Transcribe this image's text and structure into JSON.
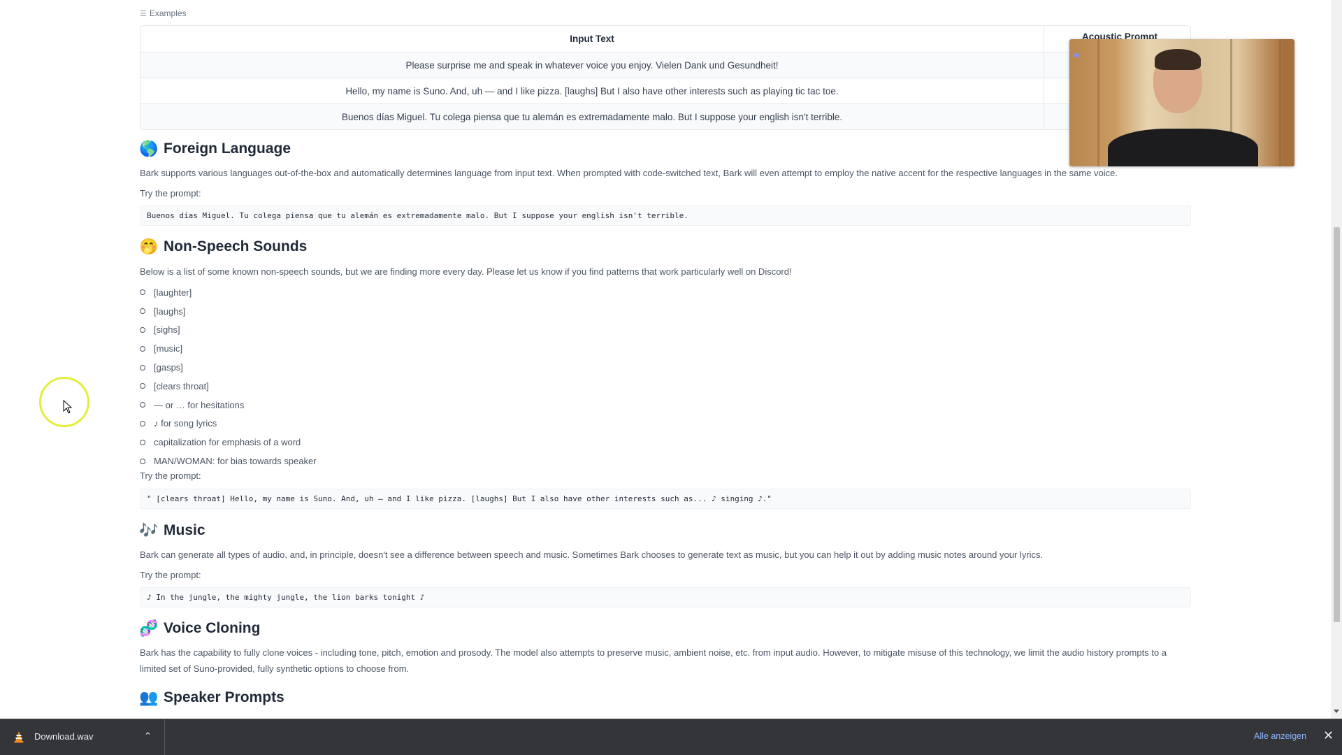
{
  "examples": {
    "label": "Examples",
    "columns": [
      "Input Text",
      "Acoustic Prompt"
    ],
    "rows": [
      {
        "input_text": "Please surprise me and speak in whatever voice you enjoy. Vielen Dank und Gesundheit!",
        "acoustic_prompt": ""
      },
      {
        "input_text": "Hello, my name is Suno. And, uh — and I like pizza. [laughs] But I also have other interests such as playing tic tac toe.",
        "acoustic_prompt": ""
      },
      {
        "input_text": "Buenos días Miguel. Tu colega piensa que tu alemán es extremadamente malo. But I suppose your english isn't terrible.",
        "acoustic_prompt": ""
      }
    ]
  },
  "sections": {
    "foreign_language": {
      "icon": "🌎",
      "title": "Foreign Language",
      "description": "Bark supports various languages out-of-the-box and automatically determines language from input text. When prompted with code-switched text, Bark will even attempt to employ the native accent for the respective languages in the same voice.",
      "try_label": "Try the prompt:",
      "prompt": "Buenos días Miguel. Tu colega piensa que tu alemán es extremadamente malo. But I suppose your english isn't terrible."
    },
    "non_speech": {
      "icon": "🤭",
      "title": "Non-Speech Sounds",
      "description": "Below is a list of some known non-speech sounds, but we are finding more every day. Please let us know if you find patterns that work particularly well on Discord!",
      "items": [
        "[laughter]",
        "[laughs]",
        "[sighs]",
        "[music]",
        "[gasps]",
        "[clears throat]",
        "— or … for hesitations",
        "♪ for song lyrics",
        "capitalization for emphasis of a word",
        "MAN/WOMAN: for bias towards speaker"
      ],
      "try_label": "Try the prompt:",
      "prompt": "\" [clears throat] Hello, my name is Suno. And, uh — and I like pizza. [laughs] But I also have other interests such as... ♪ singing ♪.\""
    },
    "music": {
      "icon": "🎶",
      "title": "Music",
      "description": "Bark can generate all types of audio, and, in principle, doesn't see a difference between speech and music. Sometimes Bark chooses to generate text as music, but you can help it out by adding music notes around your lyrics.",
      "try_label": "Try the prompt:",
      "prompt": "♪ In the jungle, the mighty jungle, the lion barks tonight ♪"
    },
    "voice_cloning": {
      "icon": "🧬",
      "title": "Voice Cloning",
      "description": "Bark has the capability to fully clone voices - including tone, pitch, emotion and prosody. The model also attempts to preserve music, ambient noise, etc. from input audio. However, to mitigate misuse of this technology, we limit the audio history prompts to a limited set of Suno-provided, fully synthetic options to choose from."
    },
    "speaker_prompts": {
      "icon": "👥",
      "title": "Speaker Prompts"
    }
  },
  "download_bar": {
    "file_name": "Download.wav",
    "show_all": "Alle anzeigen",
    "close": "✕",
    "chevron": "⌃"
  },
  "scroll": {
    "position_fraction": 0.42
  }
}
